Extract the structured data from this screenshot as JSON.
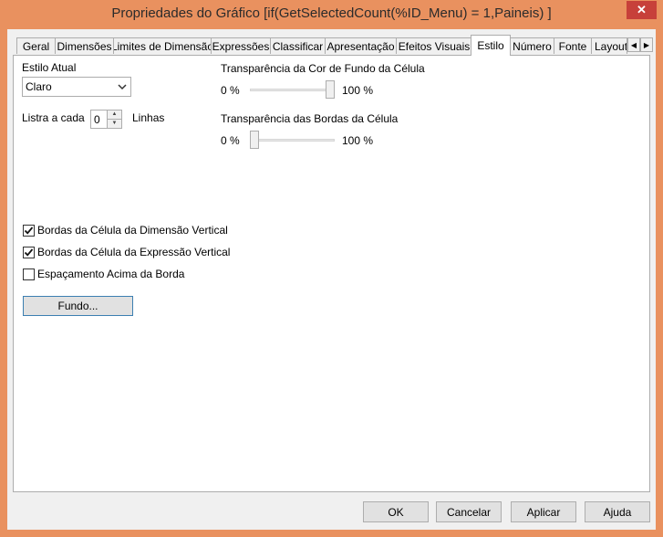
{
  "window": {
    "title": "Propriedades do Gráfico [if(GetSelectedCount(%ID_Menu) = 1,Paineis) ]",
    "close_label": "✕"
  },
  "tabs": [
    "Geral",
    "Dimensões",
    "Limites de Dimensão",
    "Expressões",
    "Classificar",
    "Apresentação",
    "Efeitos Visuais",
    "Estilo",
    "Número",
    "Fonte",
    "Layout"
  ],
  "active_tab": "Estilo",
  "estilo": {
    "estilo_atual_label": "Estilo Atual",
    "estilo_atual_value": "Claro",
    "listra_label": "Listra a cada",
    "listra_value": "0",
    "linhas_label": "Linhas",
    "fundo_transp_label": "Transparência da Cor de Fundo da Célula",
    "fundo_min": "0 %",
    "fundo_max": "100 %",
    "fundo_value_pct": 100,
    "bordas_transp_label": "Transparência das Bordas da Célula",
    "bordas_min": "0 %",
    "bordas_max": "100 %",
    "bordas_value_pct": 0,
    "checkboxes": [
      {
        "label": "Bordas da Célula da Dimensão Vertical",
        "checked": true
      },
      {
        "label": "Bordas da Célula da Expressão Vertical",
        "checked": true
      },
      {
        "label": "Espaçamento Acima da Borda",
        "checked": false
      }
    ],
    "fundo_button": "Fundo..."
  },
  "footer": {
    "ok": "OK",
    "cancel": "Cancelar",
    "apply": "Aplicar",
    "help": "Ajuda"
  }
}
